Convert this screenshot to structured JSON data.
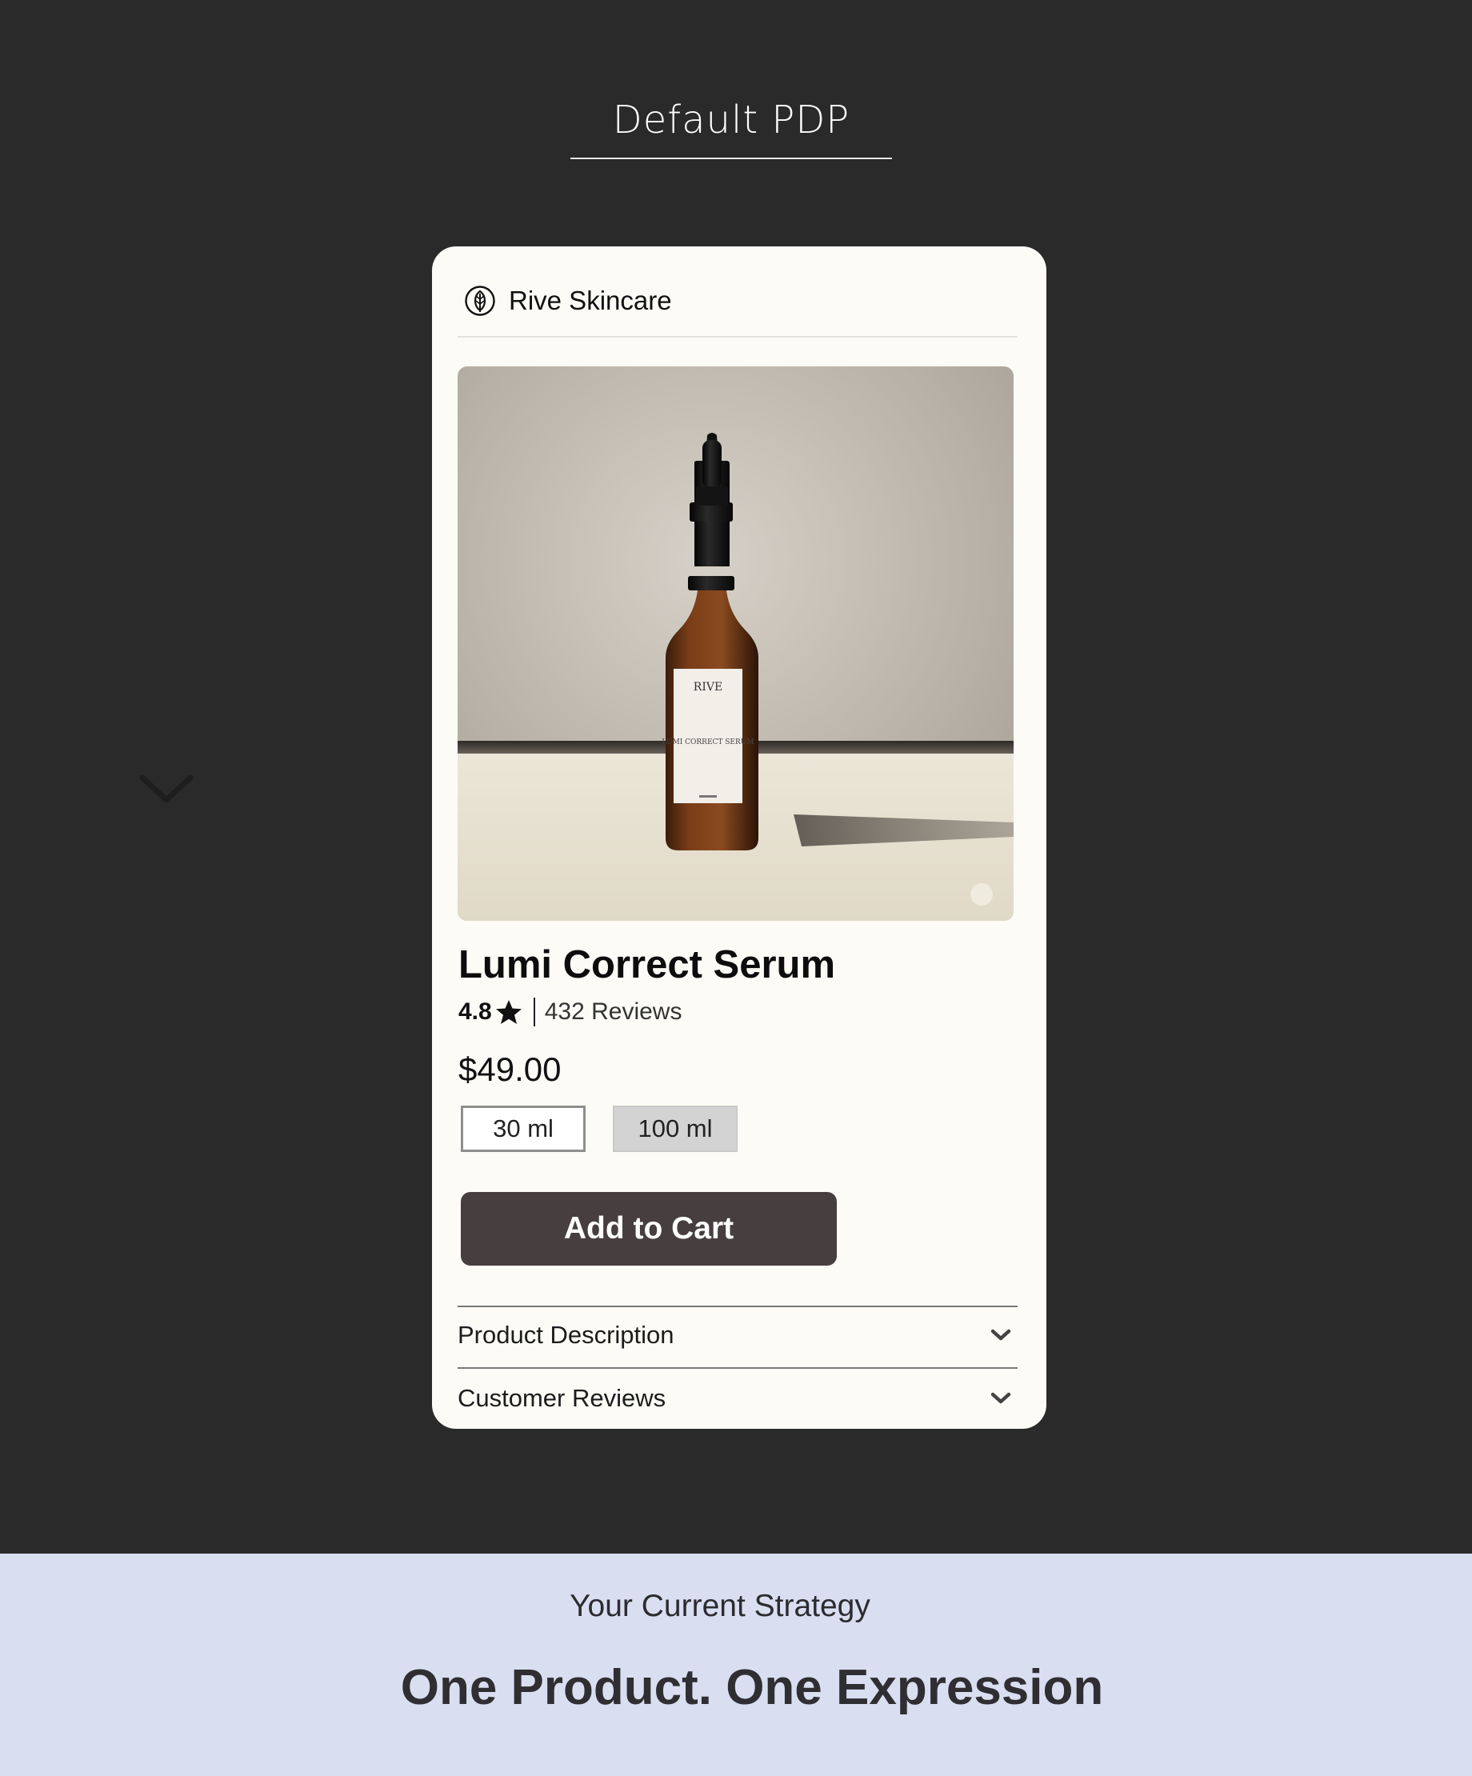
{
  "header": {
    "tab_title": "Default PDP"
  },
  "card": {
    "brand_name": "Rive Skincare",
    "brand_logo_icon": "leaf-logo-icon",
    "product_image": {
      "label_brand": "RIVE",
      "label_product": "LUMI CORRECT SERUM"
    },
    "product_title": "Lumi Correct Serum",
    "rating": {
      "value": "4.8",
      "star_icon": "star-icon",
      "reviews": "432 Reviews"
    },
    "price": "$49.00",
    "sizes": [
      {
        "label": "30 ml",
        "selected": true
      },
      {
        "label": "100 ml",
        "selected": false
      }
    ],
    "add_to_cart_label": "Add to Cart",
    "accordions": [
      {
        "label": "Product Description",
        "icon": "chevron-down-icon"
      },
      {
        "label": "Customer Reviews",
        "icon": "chevron-down-icon"
      }
    ]
  },
  "side_nav": {
    "icon": "chevron-down-icon"
  },
  "footer": {
    "strategy_label": "Your Current Strategy",
    "strategy_headline": "One Product. One Expression"
  },
  "colors": {
    "page_background": "#2a2a2a",
    "card_background": "#fcfbf6",
    "button_background": "#463e3f",
    "footer_background": "#d9dff1"
  }
}
